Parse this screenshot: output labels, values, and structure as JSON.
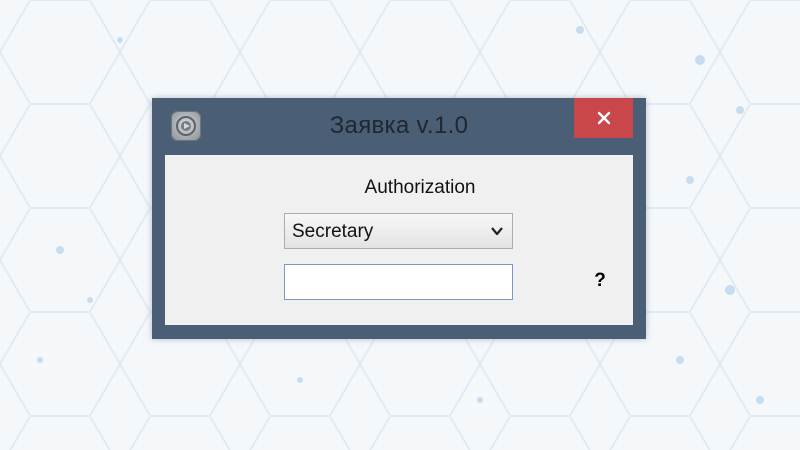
{
  "window": {
    "title": "Заявка v.1.0",
    "close_symbol": "✕"
  },
  "form": {
    "heading": "Authorization",
    "role_selected": "Secretary",
    "password_value": "",
    "help_label": "?"
  },
  "icons": {
    "app": "app-logo-icon",
    "close": "close-icon",
    "dropdown": "chevron-down-icon"
  },
  "colors": {
    "titlebar": "#4a5e75",
    "close_button": "#c9474b",
    "client_area": "#f0f0f0",
    "input_border": "#7a9cc4"
  }
}
